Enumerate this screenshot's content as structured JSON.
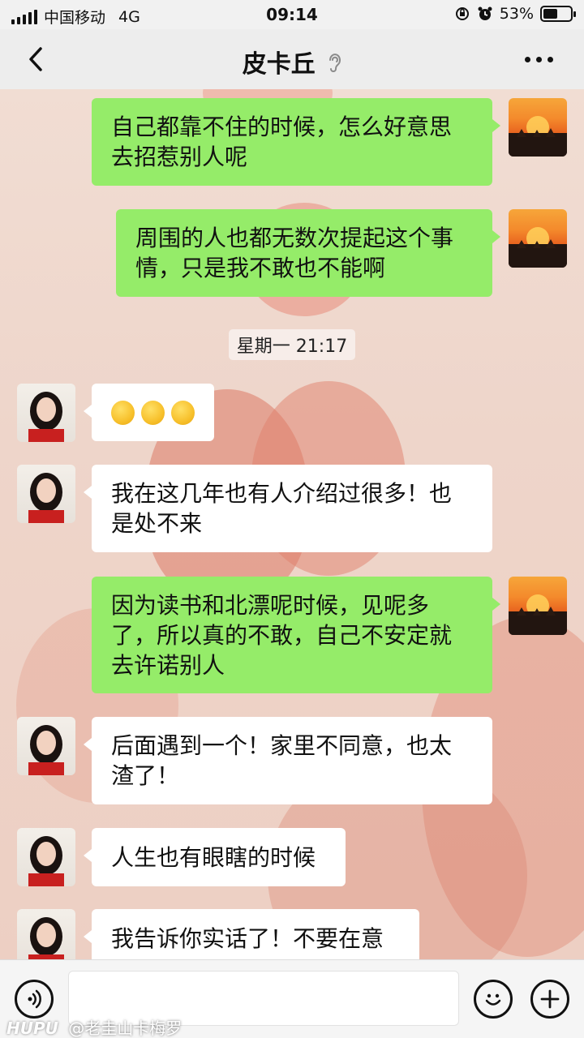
{
  "status_bar": {
    "carrier": "中国移动",
    "network": "4G",
    "time": "09:14",
    "battery": "53%",
    "battery_level": 0.53
  },
  "nav": {
    "title": "皮卡丘",
    "back_icon": "chevron-left-icon",
    "ear_icon": "ear-icon",
    "more_icon": "more-icon"
  },
  "messages": [
    {
      "sender": "self",
      "lines": [
        "自己都靠不住的时候，怎么好意思",
        "去招惹别人呢"
      ]
    },
    {
      "sender": "self",
      "lines": [
        "周围的人也都无数次提起这个事",
        "情，只是我不敢也不能啊"
      ]
    },
    {
      "sender": "peer",
      "emoji": [
        "thinking-face",
        "thinking-face",
        "thinking-face"
      ]
    },
    {
      "sender": "peer",
      "lines": [
        "我在这几年也有人介绍过很多！也",
        "是处不来"
      ]
    },
    {
      "sender": "self",
      "lines": [
        "因为读书和北漂呢时候，见呢多",
        "了，所以真的不敢，自己不安定就",
        "去许诺别人"
      ]
    },
    {
      "sender": "peer",
      "lines": [
        "后面遇到一个！家里不同意，也太",
        "渣了！"
      ]
    },
    {
      "sender": "peer",
      "lines": [
        "人生也有眼瞎的时候"
      ]
    },
    {
      "sender": "peer",
      "lines": [
        "我告诉你实话了！不要在意"
      ]
    }
  ],
  "timestamp": "星期一 21:17",
  "input_bar": {
    "voice_icon": "voice-icon",
    "emoji_icon": "emoji-icon",
    "plus_icon": "plus-icon",
    "value": ""
  },
  "watermark": {
    "logo": "HUPU",
    "text": "@老圭山卡梅罗"
  },
  "colors": {
    "self_bubble": "#95ec69",
    "peer_bubble": "#ffffff",
    "nav_background": "#ededed"
  }
}
